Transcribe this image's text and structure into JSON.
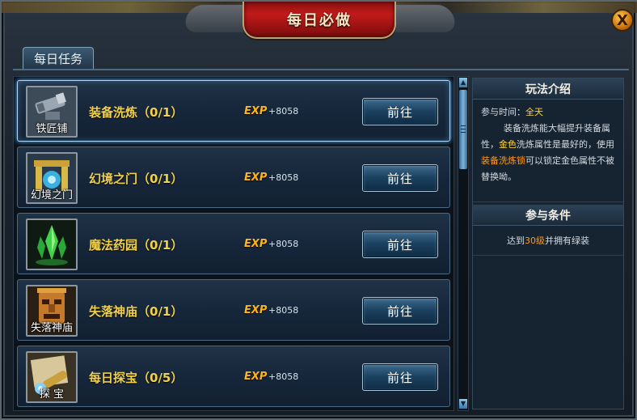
{
  "window": {
    "title": "每日必做",
    "close_label": "X"
  },
  "tabs": [
    {
      "label": "每日任务",
      "active": true
    }
  ],
  "tasks": [
    {
      "icon": "telescope-icon",
      "icon_caption": "铁匠铺",
      "name": "装备洗炼",
      "progress": "（0/1）",
      "exp_label": "EXP",
      "exp_value": "+8058",
      "button": "前往",
      "selected": true
    },
    {
      "icon": "portal-gate-icon",
      "icon_caption": "幻境之门",
      "name": "幻境之门",
      "progress": "（0/1）",
      "exp_label": "EXP",
      "exp_value": "+8058",
      "button": "前往",
      "selected": false
    },
    {
      "icon": "green-crystal-icon",
      "icon_caption": "",
      "name": "魔法药园",
      "progress": "（0/1）",
      "exp_label": "EXP",
      "exp_value": "+8058",
      "button": "前往",
      "selected": false
    },
    {
      "icon": "tiki-mask-icon",
      "icon_caption": "失落神庙",
      "name": "失落神庙",
      "progress": "（0/1）",
      "exp_label": "EXP",
      "exp_value": "+8058",
      "button": "前往",
      "selected": false
    },
    {
      "icon": "spyglass-map-icon",
      "icon_caption": "探 宝",
      "name": "每日探宝",
      "progress": "（0/5）",
      "exp_label": "EXP",
      "exp_value": "+8058",
      "button": "前往",
      "selected": false
    }
  ],
  "info": {
    "gameplay_title": "玩法介绍",
    "time_label": "参与时间：",
    "time_value": "全天",
    "desc_1": "装备洗炼能大幅提升装备属性，",
    "desc_gold": "金色",
    "desc_2": "洗炼属性是最好的，使用",
    "desc_item": "装备洗炼锁",
    "desc_3": "可以锁定金色属性不被替换呦。",
    "condition_title": "参与条件",
    "cond_1": "达到",
    "cond_level": "30级",
    "cond_2": "并拥有绿装"
  },
  "colors": {
    "task_name": "#f2d14a",
    "exp": "#ffb418",
    "highlight_gold": "#ffd53a",
    "highlight_orange": "#ff9b1c",
    "title_plate": "#c21a1a"
  }
}
